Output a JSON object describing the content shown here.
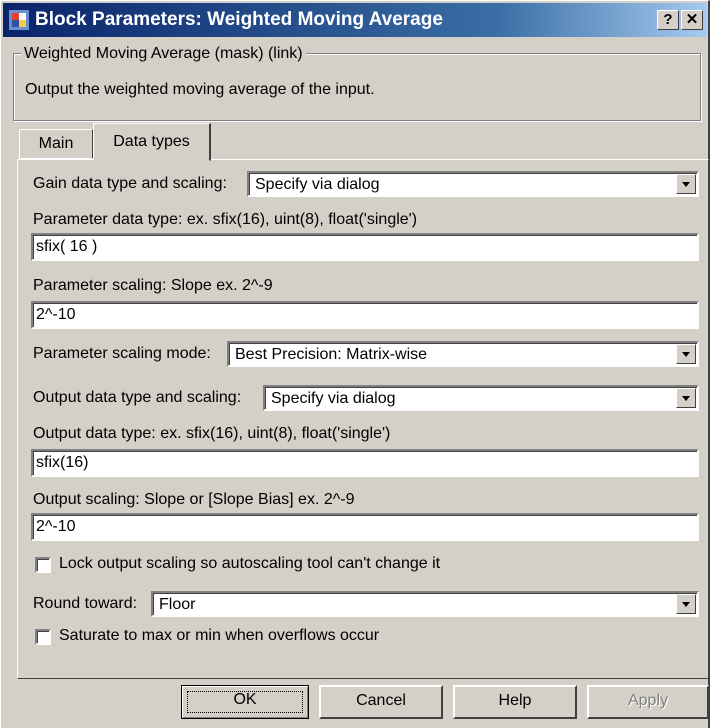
{
  "window": {
    "title": "Block Parameters: Weighted Moving Average",
    "help_button": "?",
    "close_button": "✕"
  },
  "mask": {
    "group_title": "Weighted Moving Average (mask) (link)",
    "description": "Output the weighted moving average of the input."
  },
  "tabs": [
    {
      "label": "Main",
      "active": false
    },
    {
      "label": "Data types",
      "active": true
    }
  ],
  "params": {
    "gain_label": "Gain data type and scaling:",
    "gain_value": "Specify via dialog",
    "param_type_label": "Parameter data type:    ex. sfix(16),  uint(8),  float('single')",
    "param_type_value": "sfix( 16 )",
    "param_scaling_label": "Parameter scaling:   Slope    ex.  2^-9",
    "param_scaling_value": "2^-10",
    "param_mode_label": "Parameter scaling mode:",
    "param_mode_value": "Best Precision: Matrix-wise",
    "output_label": "Output data type and scaling:",
    "output_value": "Specify via dialog",
    "output_type_label": "Output data type:    ex.  sfix(16),  uint(8),  float('single')",
    "output_type_value": "sfix(16)",
    "output_scaling_label": "Output scaling:   Slope or [Slope Bias]   ex.  2^-9",
    "output_scaling_value": "2^-10",
    "lock_label": "Lock output scaling so autoscaling tool can't change it",
    "lock_checked": false,
    "round_label": "Round toward:",
    "round_value": "Floor",
    "saturate_label": "Saturate to max or min when overflows occur",
    "saturate_checked": false
  },
  "buttons": {
    "ok": "OK",
    "cancel": "Cancel",
    "help": "Help",
    "apply": "Apply"
  }
}
